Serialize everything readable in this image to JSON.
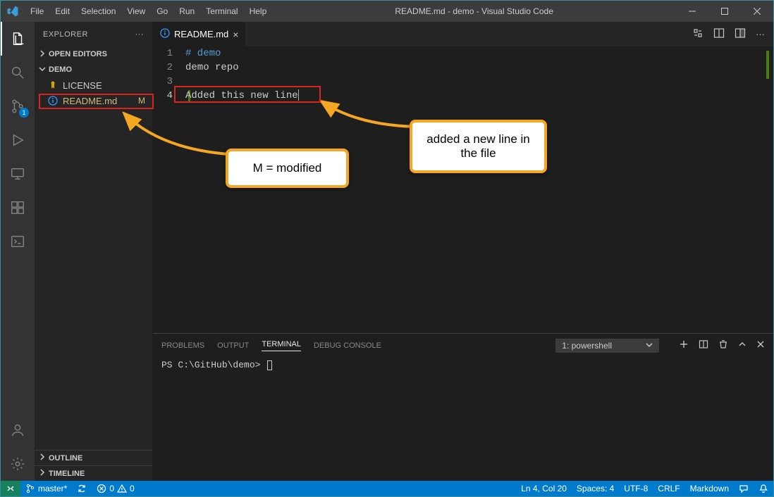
{
  "titlebar": {
    "title": "README.md - demo - Visual Studio Code",
    "menus": [
      "File",
      "Edit",
      "Selection",
      "View",
      "Go",
      "Run",
      "Terminal",
      "Help"
    ]
  },
  "activitybar": {
    "scm_badge": "1"
  },
  "sidebar": {
    "title": "EXPLORER",
    "sections": {
      "open_editors": "OPEN EDITORS",
      "folder": "DEMO",
      "outline": "OUTLINE",
      "timeline": "TIMELINE"
    },
    "files": [
      {
        "name": "LICENSE",
        "status": "",
        "modified": false
      },
      {
        "name": "README.md",
        "status": "M",
        "modified": true
      }
    ]
  },
  "tab": {
    "name": "README.md"
  },
  "editor": {
    "lines": [
      {
        "n": "1",
        "text": "# demo",
        "heading": true
      },
      {
        "n": "2",
        "text": "demo repo"
      },
      {
        "n": "3",
        "text": ""
      },
      {
        "n": "4",
        "text": "Added this new line",
        "active": true
      }
    ]
  },
  "panel": {
    "tabs": {
      "problems": "PROBLEMS",
      "output": "OUTPUT",
      "terminal": "TERMINAL",
      "debug": "DEBUG CONSOLE"
    },
    "terminal_selector": "1: powershell",
    "prompt": "PS C:\\GitHub\\demo> "
  },
  "statusbar": {
    "branch": "master*",
    "sync": "↻",
    "errors": "0",
    "warnings": "0",
    "lncol": "Ln 4, Col 20",
    "spaces": "Spaces: 4",
    "encoding": "UTF-8",
    "eol": "CRLF",
    "language": "Markdown"
  },
  "annotations": {
    "modified": "M = modified",
    "newline": "added a new line in the file"
  }
}
